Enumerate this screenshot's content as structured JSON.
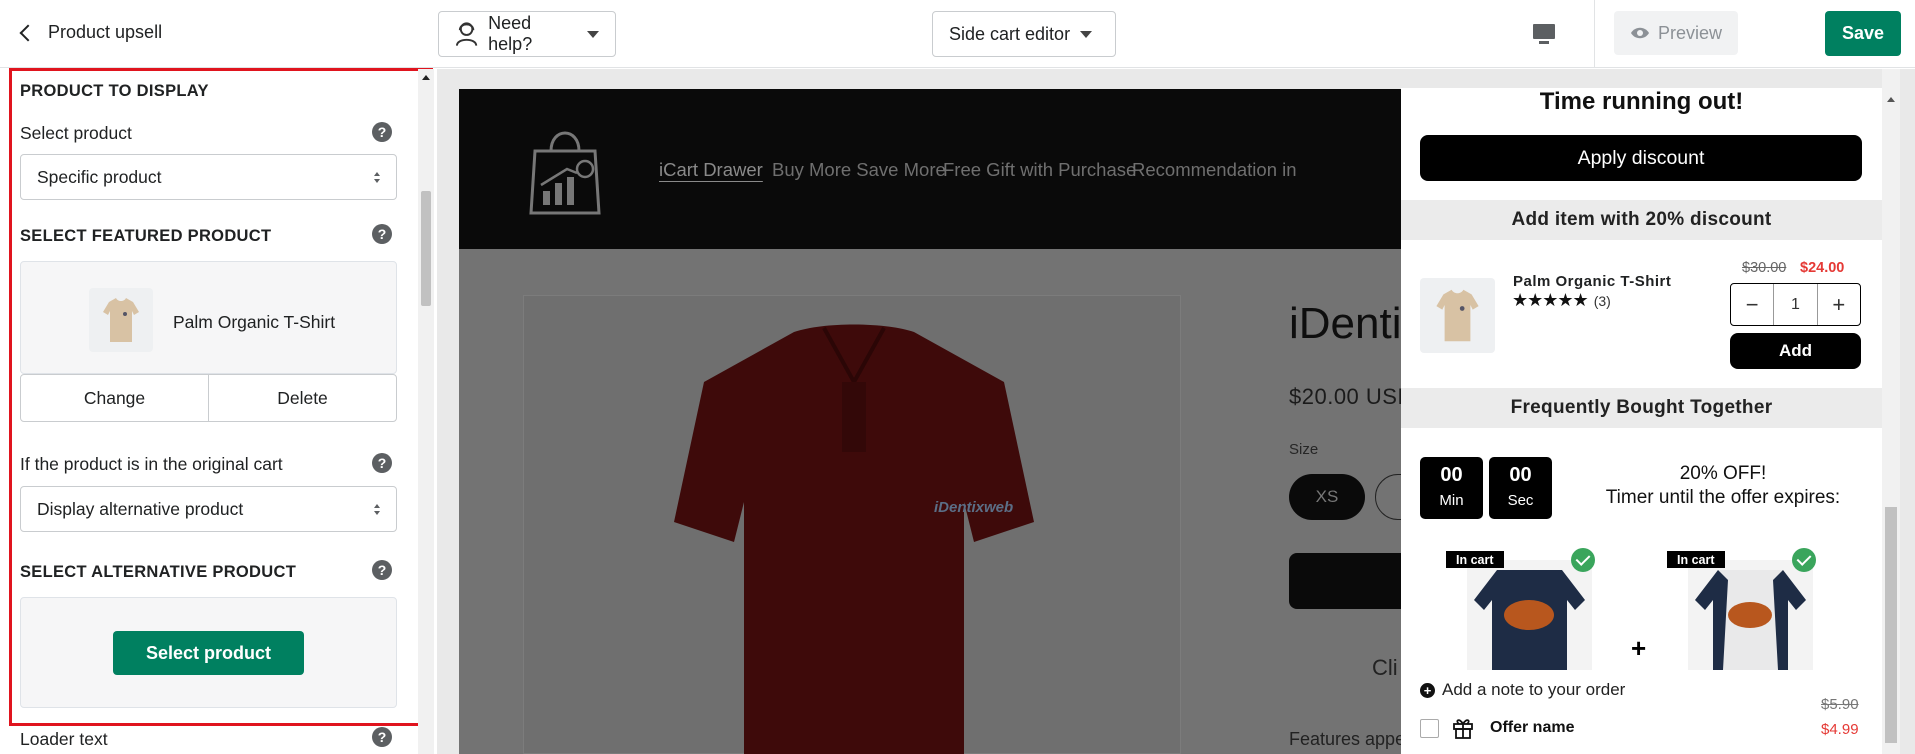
{
  "topbar": {
    "back_label": "Product upsell",
    "help_label": "Need help?",
    "editor_label": "Side cart editor",
    "preview_label": "Preview",
    "save_label": "Save"
  },
  "left_panel": {
    "section1_title": "PRODUCT TO DISPLAY",
    "select_product_label": "Select product",
    "select_product_value": "Specific product",
    "section2_title": "SELECT FEATURED PRODUCT",
    "featured_product_name": "Palm Organic T-Shirt",
    "change_label": "Change",
    "delete_label": "Delete",
    "in_cart_label": "If the product is in the original cart",
    "in_cart_value": "Display alternative product",
    "section3_title": "SELECT ALTERNATIVE PRODUCT",
    "select_product_button": "Select product",
    "loader_label": "Loader text"
  },
  "store": {
    "nav": [
      "iCart Drawer",
      "Buy More Save More",
      "Free Gift with Purchase",
      "Recommendation in"
    ],
    "product_title": "iDenti",
    "product_price": "$20.00 USD",
    "size_label": "Size",
    "sizes": [
      "XS",
      "S"
    ],
    "shirt_logo": "iDentixweb",
    "click_text": "Cli",
    "features_text": "Features appe"
  },
  "drawer": {
    "time_title": "Time running out!",
    "apply_discount": "Apply discount",
    "upsell_bar": "Add item with 20% discount",
    "upsell_product": "Palm Organic T-Shirt",
    "upsell_stars": "★★★★★",
    "upsell_reviews": "(3)",
    "upsell_old_price": "$30.00",
    "upsell_new_price": "$24.00",
    "qty_minus": "−",
    "qty_value": "1",
    "qty_plus": "+",
    "add_label": "Add",
    "fbt_bar": "Frequently Bought Together",
    "timer_min_value": "00",
    "timer_min_label": "Min",
    "timer_sec_value": "00",
    "timer_sec_label": "Sec",
    "offer_headline": "20% OFF!",
    "offer_sub": "Timer until the offer expires:",
    "in_cart_badge": "In cart",
    "plus_sign": "+",
    "note_label": "Add a note to your order",
    "offer_name": "Offer name",
    "offer_old_price": "$5.90",
    "offer_new_price": "$4.99"
  },
  "colors": {
    "primary_green": "#008060",
    "highlight_red": "#e0141e",
    "sale_red": "#e53935",
    "check_green": "#3aa55c"
  }
}
